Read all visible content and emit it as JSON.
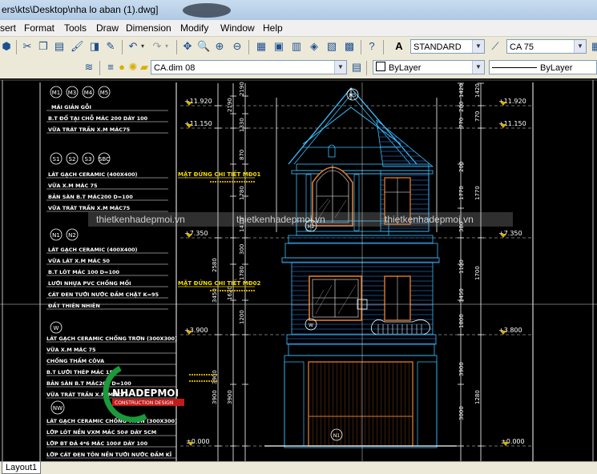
{
  "window": {
    "title": "ers\\kts\\Desktop\\nha lo aban (1).dwg]"
  },
  "menu": [
    "sert",
    "Format",
    "Tools",
    "Draw",
    "Dimension",
    "Modify",
    "Window",
    "Help"
  ],
  "toolbar": {
    "text_style": "STANDARD",
    "dim_style": "CA 75",
    "layer": "CA.dim 08",
    "color": "ByLayer",
    "linetype": "ByLayer"
  },
  "watermarks": [
    "thietkenhadepmoi.vn",
    "thietkenhadepmoi.vn",
    "thietkenhadepmoi.vn"
  ],
  "logo": {
    "brand": "NHADEPMOI",
    "tagline": "CONSTRUCTION DESIGN"
  },
  "notes": {
    "m_tags": [
      "M1",
      "M3",
      "M4",
      "M5"
    ],
    "m_lines": [
      "MÁI GIẢN GỖI",
      "B.T ĐỔ TẠI CHỖ MÁC 200 DÀY 100",
      "VỮA TRÁT TRẦN X.M MÁC75"
    ],
    "s_tags": [
      "S1",
      "S2",
      "S3",
      "SBC"
    ],
    "s_lines": [
      "LÁT GẠCH CERAMIC (400X400)",
      "VỮA X.M MÁC 75",
      "BẢN SÀN B.T MÁC200 D=100",
      "VỮA TRÁT TRẦN X.M MÁC75"
    ],
    "n_tags": [
      "N1",
      "N2"
    ],
    "n_lines": [
      "LÁT GẠCH CERAMIC (400X400)",
      "VỮA LÁT X.M MÁC 50",
      "B.T LÓT MÁC 100 D=100",
      "LƯỚI NHỰA PVC CHỐNG MỐI",
      "CÁT ĐEN TƯỚI NƯỚC ĐẦM CHẶT K=95",
      "ĐẤT THIÊN NHIÊN"
    ],
    "w_tags": [
      "W"
    ],
    "w_lines": [
      "LÁT GẠCH CERAMIC CHỐNG TRƠN (300X300)",
      "VỮA X.M MÁC 75",
      "CHỐNG THẤM CÔVA",
      "B.T LƯỚI THÉP MÁC 150",
      "BẢN SÀN B.T MÁC200 D=100",
      "VỮA TRÁT TRẦN X.M MÁC75"
    ],
    "nw_tags": [
      "NW"
    ],
    "nw_lines": [
      "LÁT GẠCH CERAMIC CHỐNG TRƠN (300X300)",
      "LỚP LÓT NỀN VXM MÁC 50# DÀY 5CM",
      "LỚP BT ĐÁ 4*6 MÁC 100# DÀY 100",
      "LỚP CÁT ĐEN TÔN NỀN TƯỚI NƯỚC ĐẦM KĨ"
    ]
  },
  "levels_left": [
    "+11.920",
    "+11.150",
    "+7.350",
    "+3.900",
    "±0.000"
  ],
  "levels_right": [
    "+11.920",
    "+11.150",
    "+7.350",
    "+3.800",
    "±0.000"
  ],
  "detail_labels": [
    "MẶT ĐỨNG CHI TIẾT MĐ01",
    "MẶT ĐỨNG CHI TIẾT MĐ02"
  ],
  "markers": [
    "M5",
    "M2",
    "W",
    "N1"
  ],
  "dims_left_outer": [
    "2580",
    "3450",
    "3900",
    "3900"
  ],
  "dims_left_inner": [
    "2190",
    "1330",
    "870",
    "1780",
    "1410",
    "300",
    "1780",
    "1620",
    "1200"
  ],
  "dims_right_outer": [
    "1420",
    "770",
    "1770",
    "1700",
    "1280"
  ],
  "dims_right_inner": [
    "1420",
    "200",
    "770",
    "200",
    "1770",
    "380",
    "1100",
    "3450",
    "1800",
    "3900",
    "3000"
  ],
  "layout_tab": "Layout1"
}
